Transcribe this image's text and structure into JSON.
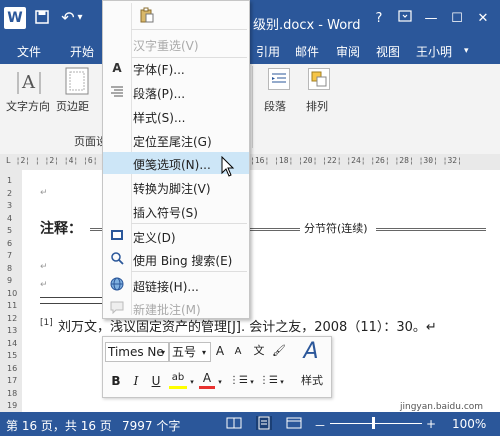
{
  "window": {
    "title_partial": "级别.docx - Word",
    "help": "?",
    "restore_ribbon": "▣",
    "minimize": "—",
    "maximize": "☐",
    "close": "✕"
  },
  "qat": {
    "app_icon": "W",
    "save": "💾",
    "undo": "↶",
    "undo_dropdown": "▾"
  },
  "tabs": {
    "file": "文件",
    "home": "开始",
    "references": "引用",
    "mailings": "邮件",
    "review": "审阅",
    "view": "视图",
    "user": "王小明",
    "user_arrow": "▾"
  },
  "ribbon": {
    "text_direction": "文字方向",
    "margins": "页边距",
    "page_setup_group": "页面设",
    "paragraph": "段落",
    "arrange": "排列"
  },
  "ruler": {
    "left_text": "L  ¦2¦ ¦ ¦2¦ ¦4¦ ¦6¦",
    "right_text": "¦16¦ ¦18¦ ¦20¦ ¦22¦ ¦24¦ ¦26¦ ¦28¦ ¦30¦ ¦32¦",
    "vertical_numbers": [
      "1",
      "2",
      "3",
      "4",
      "5",
      "6",
      "7",
      "8",
      "9",
      "10",
      "11",
      "12",
      "13",
      "14",
      "15",
      "16",
      "17",
      "18",
      "19"
    ]
  },
  "document": {
    "pilcrow": "↵",
    "note_label": "注释：",
    "section_break": "分节符(连续)",
    "ref_marker": "[1]",
    "ref_text": "刘万文，浅议固定资产的管理[J]. 会计之友，2008（11）：30。↵"
  },
  "context_menu": {
    "items": [
      {
        "label": "",
        "icon": "paste-icon"
      },
      {
        "label": "汉字重选(V)",
        "disabled": true
      },
      {
        "label": "字体(F)...",
        "icon": "font-icon"
      },
      {
        "label": "段落(P)...",
        "icon": "paragraph-icon"
      },
      {
        "label": "样式(S)..."
      },
      {
        "label": "定位至尾注(G)"
      },
      {
        "label": "便笺选项(N)...",
        "highlighted": true
      },
      {
        "label": "转换为脚注(V)"
      },
      {
        "label": "插入符号(S)"
      },
      {
        "label": "定义(D)",
        "icon": "book-icon"
      },
      {
        "label": "使用 Bing 搜索(E)",
        "icon": "bing-search-icon"
      },
      {
        "label": "超链接(H)...",
        "icon": "hyperlink-icon"
      },
      {
        "label": "新建批注(M)",
        "icon": "comment-icon",
        "disabled": true
      }
    ]
  },
  "mini_toolbar": {
    "font_name": "Times Ne",
    "font_size": "五号",
    "grow_font": "A",
    "shrink_font": "A",
    "phonetic": "文",
    "format_painter": "🖌",
    "styles_label": "样式",
    "bold": "B",
    "italic": "I",
    "underline": "U",
    "highlight": "ab",
    "font_color": "A",
    "bullets": "⋮☰",
    "numbering": "⋮☰"
  },
  "status_bar": {
    "page": "第 16 页，共 16 页",
    "words": "7997 个字",
    "zoom": "100%",
    "zoom_minus": "－",
    "zoom_plus": "+",
    "watermark": "jingyan.baidu.com"
  },
  "colors": {
    "word_blue": "#2b579a",
    "menu_highlight": "#cde6f7",
    "highlight_yellow": "#ffff00",
    "font_red": "#e8312f"
  }
}
